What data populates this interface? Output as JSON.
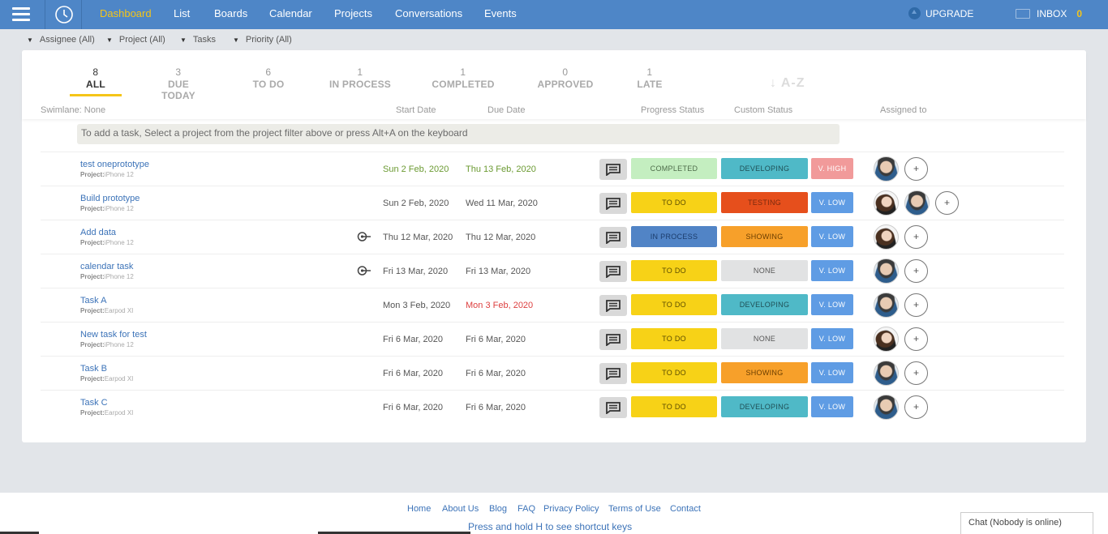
{
  "nav": {
    "items": [
      "Dashboard",
      "List",
      "Boards",
      "Calendar",
      "Projects",
      "Conversations",
      "Events"
    ],
    "upgrade_label": "UPGRADE",
    "inbox_label": "INBOX",
    "inbox_count": "0",
    "icons": [
      "menu-icon",
      "clock-icon",
      "upgrade-icon",
      "inbox-icon"
    ]
  },
  "filters": [
    "Assignee (All)",
    "Project (All)",
    "Tasks",
    "Priority (All)"
  ],
  "tabs": [
    {
      "count": "8",
      "label": "ALL"
    },
    {
      "count": "3",
      "label": "DUE TODAY"
    },
    {
      "count": "6",
      "label": "TO DO"
    },
    {
      "count": "1",
      "label": "IN PROCESS"
    },
    {
      "count": "1",
      "label": "COMPLETED"
    },
    {
      "count": "0",
      "label": "APPROVED"
    },
    {
      "count": "1",
      "label": "LATE"
    }
  ],
  "sort_label": "↓ A-Z",
  "columns": {
    "swimlane": "Swimlane: None",
    "start": "Start Date",
    "due": "Due Date",
    "progress": "Progress Status",
    "custom": "Custom Status",
    "assigned": "Assigned to"
  },
  "hint": "To add a task, Select a project from the project filter above or press Alt+A on the keyboard",
  "project_prefix": "Project:",
  "tasks": [
    {
      "name": "test oneprototype",
      "project": "iPhone 12",
      "start": "Sun 2 Feb, 2020",
      "due": "Thu 13 Feb, 2020",
      "date_color": "green",
      "progress": "COMPLETED",
      "custom": "DEVELOPING",
      "priority": "V. HIGH",
      "dependency": false,
      "assignees": [
        "man"
      ]
    },
    {
      "name": "Build prototype",
      "project": "iPhone 12",
      "start": "Sun 2 Feb, 2020",
      "due": "Wed 11 Mar, 2020",
      "date_color": "normal",
      "progress": "TO DO",
      "custom": "TESTING",
      "priority": "V. LOW",
      "dependency": false,
      "assignees": [
        "woman",
        "man"
      ]
    },
    {
      "name": "Add data",
      "project": "iPhone 12",
      "start": "Thu 12 Mar, 2020",
      "due": "Thu 12 Mar, 2020",
      "date_color": "normal",
      "progress": "IN PROCESS",
      "custom": "SHOWING",
      "priority": "V. LOW",
      "dependency": true,
      "assignees": [
        "woman"
      ]
    },
    {
      "name": "calendar task",
      "project": "iPhone 12",
      "start": "Fri 13 Mar, 2020",
      "due": "Fri 13 Mar, 2020",
      "date_color": "normal",
      "progress": "TO DO",
      "custom": "NONE",
      "priority": "V. LOW",
      "dependency": true,
      "assignees": [
        "man"
      ]
    },
    {
      "name": "Task A",
      "project": "Earpod XI",
      "start": "Mon 3 Feb, 2020",
      "due": "Mon 3 Feb, 2020",
      "date_color": "red",
      "progress": "TO DO",
      "custom": "DEVELOPING",
      "priority": "V. LOW",
      "dependency": false,
      "assignees": [
        "man"
      ]
    },
    {
      "name": "New task for test",
      "project": "iPhone 12",
      "start": "Fri 6 Mar, 2020",
      "due": "Fri 6 Mar, 2020",
      "date_color": "normal",
      "progress": "TO DO",
      "custom": "NONE",
      "priority": "V. LOW",
      "dependency": false,
      "assignees": [
        "woman"
      ]
    },
    {
      "name": "Task B",
      "project": "Earpod XI",
      "start": "Fri 6 Mar, 2020",
      "due": "Fri 6 Mar, 2020",
      "date_color": "normal",
      "progress": "TO DO",
      "custom": "SHOWING",
      "priority": "V. LOW",
      "dependency": false,
      "assignees": [
        "man"
      ]
    },
    {
      "name": "Task C",
      "project": "Earpod XI",
      "start": "Fri 6 Mar, 2020",
      "due": "Fri 6 Mar, 2020",
      "date_color": "normal",
      "progress": "TO DO",
      "custom": "DEVELOPING",
      "priority": "V. LOW",
      "dependency": false,
      "assignees": [
        "man"
      ]
    }
  ],
  "colors": {
    "nav_bg": "#4e86c7",
    "accent": "#f5c518",
    "COMPLETED": "#c4eec0",
    "TO DO": "#f7d217",
    "IN PROCESS": "#5184c6",
    "DEVELOPING": "#4fb9c7",
    "TESTING": "#e64f1c",
    "SHOWING": "#f7a02a",
    "NONE": "#e1e2e3",
    "V. HIGH": "#f19a9a",
    "V. LOW": "#5f9ce4"
  },
  "footer": {
    "links": [
      "Home",
      "About Us",
      "Blog",
      "FAQ",
      "Privacy Policy",
      "Terms of Use",
      "Contact"
    ],
    "shortcut": "Press and hold H to see shortcut keys",
    "chat": "Chat (Nobody is online)"
  }
}
